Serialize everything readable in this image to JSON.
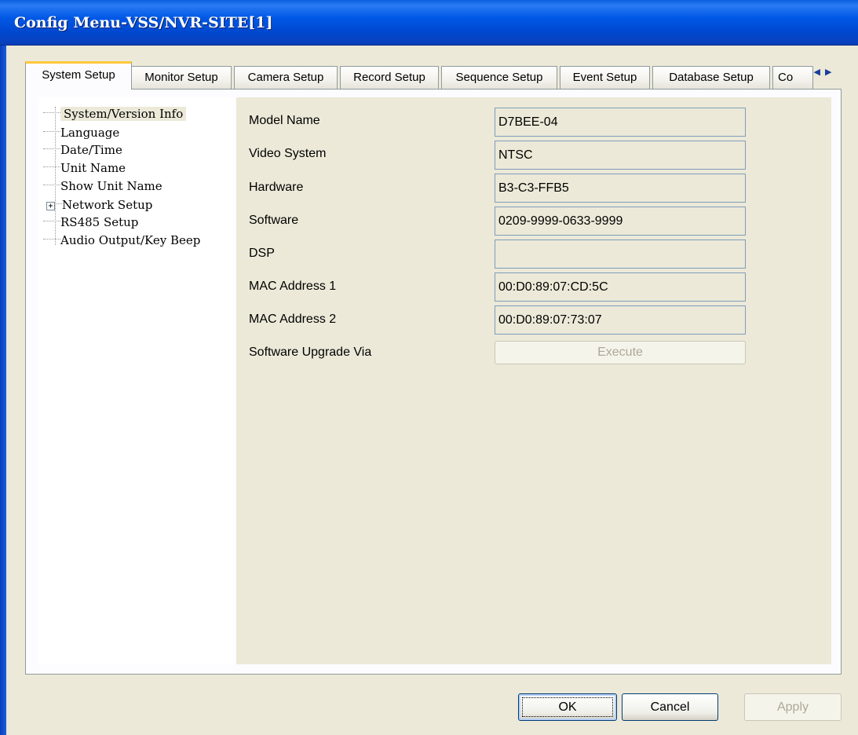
{
  "window": {
    "title": "Config Menu-VSS/NVR-SITE[1]"
  },
  "tabs": [
    {
      "label": "System Setup",
      "active": true
    },
    {
      "label": "Monitor Setup"
    },
    {
      "label": "Camera Setup"
    },
    {
      "label": "Record Setup"
    },
    {
      "label": "Sequence Setup"
    },
    {
      "label": "Event Setup"
    },
    {
      "label": "Database Setup"
    },
    {
      "label": "Co"
    }
  ],
  "tab_scroll": {
    "left": "◀",
    "right": "▶"
  },
  "tree": {
    "items": [
      {
        "label": "System/Version Info",
        "selected": true
      },
      {
        "label": "Language"
      },
      {
        "label": "Date/Time"
      },
      {
        "label": "Unit Name"
      },
      {
        "label": "Show Unit Name"
      },
      {
        "label": "Network Setup",
        "expandable": true,
        "expander": "+"
      },
      {
        "label": "RS485 Setup"
      },
      {
        "label": "Audio Output/Key Beep"
      }
    ]
  },
  "info": {
    "rows": [
      {
        "label": "Model Name",
        "value": "D7BEE-04"
      },
      {
        "label": "Video System",
        "value": "NTSC"
      },
      {
        "label": "Hardware",
        "value": "B3-C3-FFB5"
      },
      {
        "label": "Software",
        "value": "0209-9999-0633-9999"
      },
      {
        "label": "DSP",
        "value": ""
      },
      {
        "label": "MAC Address 1",
        "value": "00:D0:89:07:CD:5C"
      },
      {
        "label": "MAC Address 2",
        "value": "00:D0:89:07:73:07"
      }
    ],
    "upgrade_label": "Software Upgrade Via",
    "execute_label": "Execute"
  },
  "buttons": {
    "ok": "OK",
    "cancel": "Cancel",
    "apply": "Apply"
  },
  "colors": {
    "titlebar": "#0058e6",
    "panel_bg": "#ece9d8",
    "active_tab_accent": "#ffc83c"
  }
}
